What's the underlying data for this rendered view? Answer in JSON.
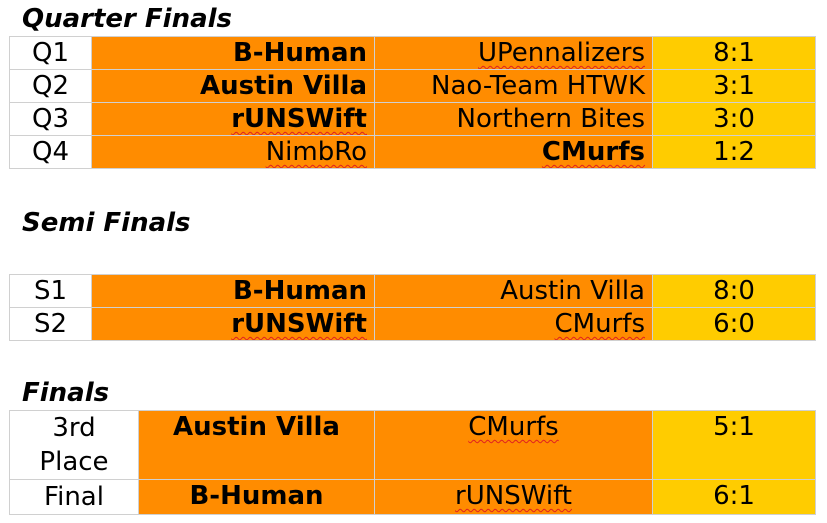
{
  "quarter": {
    "title": "Quarter Finals",
    "rows": [
      {
        "code": "Q1",
        "team1": "B-Human",
        "team2": "UPennalizers",
        "score": "8:1",
        "winner": 1
      },
      {
        "code": "Q2",
        "team1": "Austin Villa",
        "team2": "Nao-Team HTWK",
        "score": "3:1",
        "winner": 1
      },
      {
        "code": "Q3",
        "team1": "rUNSWift",
        "team2": "Northern Bites",
        "score": "3:0",
        "winner": 1
      },
      {
        "code": "Q4",
        "team1": "NimbRo",
        "team2": "CMurfs",
        "score": "1:2",
        "winner": 2
      }
    ]
  },
  "semi": {
    "title": "Semi Finals",
    "rows": [
      {
        "code": "S1",
        "team1": "B-Human",
        "team2": "Austin Villa",
        "score": "8:0",
        "winner": 1
      },
      {
        "code": "S2",
        "team1": "rUNSWift",
        "team2": "CMurfs",
        "score": "6:0",
        "winner": 1
      }
    ]
  },
  "finals": {
    "title": "Finals",
    "rows": [
      {
        "code": "3rd Place",
        "team1": "Austin Villa",
        "team2": "CMurfs",
        "score": "5:1",
        "winner": 1
      },
      {
        "code": "Final",
        "team1": "B-Human",
        "team2": "rUNSWift",
        "score": "6:1",
        "winner": 1
      }
    ]
  },
  "colors": {
    "team_cell": "#ff8c00",
    "score_cell": "#ffcc00",
    "code_cell": "#ffffff",
    "grid": "#d0d0d0",
    "spellcheck": "#e02020"
  }
}
